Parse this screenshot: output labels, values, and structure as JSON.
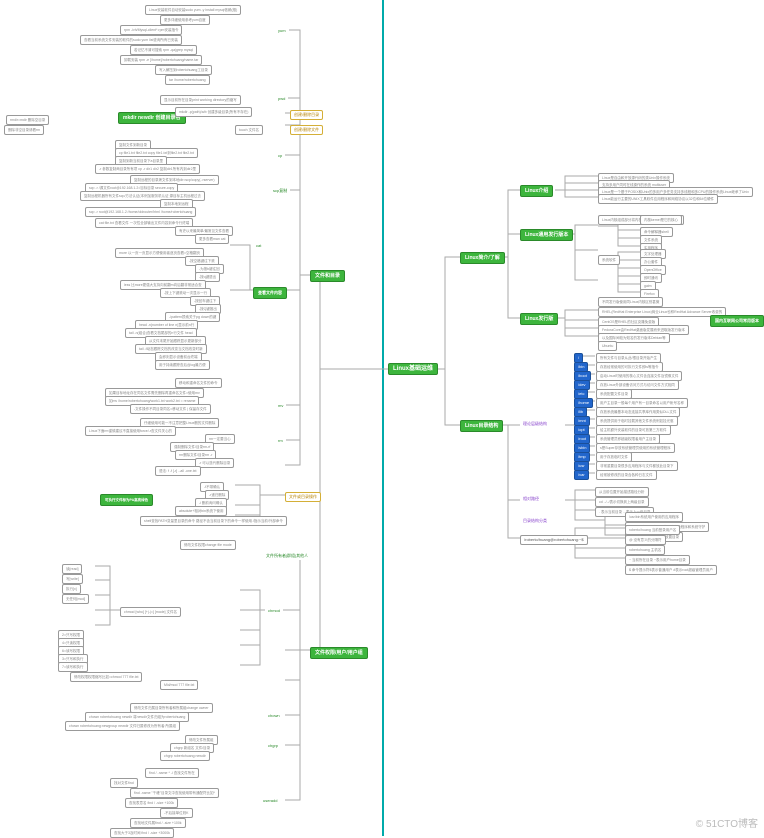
{
  "watermark": "© 51CTO博客",
  "root": "Linux基础运维",
  "right": {
    "intro": {
      "label": "Linux简介/了解",
      "what": {
        "label": "Linux介绍",
        "items": [
          "Linux是自由和开放源代码的类Unix操作系统",
          "支持多用户同时在线操作的系统 multiuser",
          "Linux是一个基于POSIX和Unix的多用户多任务支持多线程和多CPU的操作系统Linux继承了Unix",
          "Linux能运行主要的UNIX工具软件应用程序和网络协议以32位和64位硬件"
        ]
      },
      "distro": {
        "label": "Linux通用发行版本",
        "items": [
          {
            "label": "Linux内核组成部分将内核与不同的应用与服务结合",
            "sub": [
              "内核kernel是它的核心",
              "命令解释器shell",
              "文件系统",
              "实用程序"
            ]
          },
          {
            "label": "系统软件",
            "sub": [
              "文字处理器",
              "GIMP图像",
              "办公套件",
              "OpenOffice",
              "即时通讯",
              "gaim",
              "浏览器",
              "Firefox"
            ]
          },
          {
            "label": "不同发行版使用同Linux内核区别甚微",
            "sub": []
          }
        ]
      },
      "fedora": {
        "label": "Linux发行版",
        "items": [
          "RHEL(RedHat Enterprise Linux)商业Linux也称RedHat Advance Server收费的",
          "CentOS是RHEL的社区克隆免费版",
          "FedoraCore由RedHat桌面版发展而来进取版发行版本",
          "以及国际间较为知名的发行版本Debian等",
          "Ubuntu"
        ],
        "tag": "国内互联网公司常用版本"
      }
    },
    "dir": {
      "label": "Linux目录结构",
      "mainpoint": {
        "label": "理论层级结构",
        "items": [
          {
            "tag": "/",
            "text": "所有文件与目录从此/根目录开始产生"
          },
          {
            "tag": "/bin",
            "text": "存放经常使用的可执行文件即ls等指令"
          },
          {
            "tag": "/boot",
            "text": "启动Linux时使用的核心文件含连接文件及镜像文件"
          },
          {
            "tag": "/dev",
            "text": "存放Linux外部设备访问方式与访问文件方式相同"
          },
          {
            "tag": "/etc",
            "text": "系统配置文件目录"
          },
          {
            "tag": "/home",
            "text": "用户主目录一般每个用户有一目录命名以用户帐号名称"
          },
          {
            "tag": "/lib",
            "text": "存放系统最基本动态连接共享库作用类似DLL文件"
          },
          {
            "tag": "/mnt",
            "text": "系统提供用于临时挂载其他文件系统例如挂光驱"
          },
          {
            "tag": "/opt",
            "text": "给主机额外安装软件的目录可放第三方软件"
          },
          {
            "tag": "/root",
            "text": "系统管理员即超级权限者用户主目录"
          },
          {
            "tag": "/sbin",
            "text": "s是Super存放系统管理员使用的系统管理程序"
          },
          {
            "tag": "/tmp",
            "text": "用于存放临时文件"
          },
          {
            "tag": "/usr",
            "text": "非常重要目录很多应用程序与文件都放此目录下",
            "sub": [
              "/usr/bin系统用户使用的应用程序",
              "/usr/sbin超级用户使用的比较高级程序和系统守护",
              "/usr/src内核源代码默认放置目录"
            ]
          },
          {
            "tag": "/var",
            "text": "经常被修改的目录含各种日志文件"
          }
        ]
      },
      "relpath": {
        "label": "相对路径",
        "items": [
          "从当前位置开始描述路径分析",
          "cd ../../表示切换到上两级目录",
          ". 表示当前目录 .. 表示上一级目录"
        ]
      },
      "format": {
        "label": "目录结构分类",
        "items": [
          "严格区分大小写",
          "目录与文件名称不能超过255字符",
          "除了/之外所有字符都合法",
          "-. 空格字符最好不要使用"
        ]
      },
      "user": {
        "label": "/roberto/huang@robertohuang:~$",
        "items": [
          "roberto/huang 当前登录用户名",
          "@ 没有意义的分隔符",
          "robertohuang 主机名",
          "~ 当前所在目录 ~表示用户home目录",
          "$ 命令提示符$表示普通用户 #表示root超级管理员用户"
        ]
      }
    }
  },
  "left": {
    "yum": {
      "label": "yum",
      "items": [
        "Linux安装软件自动安装sudo yum -y install mysql依赖(推)",
        "更多详细使用参考yum百度",
        "rpm -ivh/Mysql-client*.rpm安装指令",
        "查看当前系统文件安装的软件的sudo yum list查询所有已安装",
        "若记忆不清可搜索 rpm -qa|grep mysql",
        "卸载安装 rpm -e [/home]/robertohuang/name.tar",
        "写入解压到robertohuang工目录",
        "tar /home/robertohuang"
      ]
    },
    "pwd": {
      "label": "pwd",
      "text": "显示目前所在目录print working directory的缩写"
    },
    "mkdir": {
      "label": "创建/删除目录",
      "items": [
        "mkdir newdir 创建目录名",
        "mkdir -p(path)/a/b 创建多级目录(所有不存在)",
        "rmdir=mdir 删除空目录",
        "删除非空目录请看rm"
      ]
    },
    "touch": {
      "label": "创建/删除文件",
      "items": [
        "touch 文件名"
      ]
    },
    "cp": {
      "label": "cp",
      "items": [
        "复制文件到新目录",
        "cp file1.txt file2.txt copy file1.txt到file2.txt file2.txt",
        "复制到新当前目录下a目录里",
        "-r 参数复制两目录所有项 cp -r dir1 dir2 复制dir1所有内到dir2里",
        "远程拷贝 scp/server-copy文件"
      ]
    },
    "scp": {
      "label": "scp复制",
      "items": [
        "复制远程的目录拷文件到本地dir=scp/copy(->server)",
        "scp -r /源文件root@192.168.1.2:/目标目录 secure-copy",
        "复制远程机器所有文件scp/方法认证(本例加服务机认证 源目标主机远程过去",
        "复制本地到远程",
        "scp -r root@192.168.1.2:/home/oldrouter/html /home/robertohuang"
      ]
    },
    "filedir": {
      "label": "文件和目录",
      "cat": {
        "label": "cat",
        "items": [
          "cat file.txt 查看文件 一次性全部输出文件内容到命令行终端",
          "有史以来最简单/最常见文件查看",
          "更多查看man cat"
        ]
      },
      "view": {
        "label": "查看文件内容",
        "items": [
          "more 以一页一页显示方便使用者逐页查看=空格翻页",
          "-按空格键往下滚",
          "-为按b键往回",
          "-按q键退出",
          "less 比more更强大支持向前翻m向后翻非常适合查",
          "-按上下键滚动一次显示一行",
          "-按回车键往下",
          "-按Q键推出",
          "-/pattern损索关于pg down的键",
          "head -n(number of line n)显示前n行",
          "tail -n(组合)查看文档尾部的n行文件 head",
          "从文件末尾开始跟踪显示更新部分",
          "tail -f动态跟踪文档的改变当文档改变时新",
          "会即刻显示设备前台终端",
          "用于持续跟踪查后台log最方便"
        ]
      },
      "mv": {
        "label": "mv",
        "items": [
          "移动和重命名文件的命令",
          "如果目标地址存在同名文件需先删除再重命名文件=使用mv",
          "如mv /home/robertohuang/work1.txt work2.txt = rename",
          "-文件操作不同目录同名=移动文件 | 保留存文件"
        ]
      },
      "rm": {
        "label": "rm",
        "items": [
          "仔细使用可能一不注意把整Linux删的文件删除",
          "Linux下面rm谨慎建议不直接使用force/-r查文件关心的",
          "rm一定要当心",
          "强制删除文件/目录rm-rf",
          "rm删除文件/目录rm -r",
          "-r 可以迭代删除目录",
          "语法: f -f [-r] .-all    -one.txt"
        ]
      },
      "special": {
        "label": "文件或目录操作",
        "items": [
          "-f不带确认",
          "-r递归删除",
          "-i 删前询问确认",
          "absolute+相对bin系统下使用",
          "目录需加-f指定使用\\",
          "可执行文件标为PA高亮绿色",
          "shell查找PATH变量里目录的命令 路径不含当前目录下的命令一样使用./指示当前/外部命令"
        ]
      }
    },
    "chmod": {
      "label": "chmod",
      "desc": "修改文件权限change file mode",
      "table": {
        "rows": [
          [
            "权限",
            "读[read]",
            "r",
            "4",
            "可选标识权限"
          ],
          [
            "",
            "写[write]",
            "w",
            "2",
            "可修改文件"
          ],
          [
            "",
            "执行[x]",
            "x",
            "1",
            ""
          ],
          [
            "",
            "无任何[mod]",
            "-",
            "0",
            ""
          ]
        ]
      },
      "roles": "文件所有者|群组|其他人",
      "command": "chmod [who] [+|-|=] [mode] 文件名",
      "examples": [
        "2=只写权限",
        "4=只读权限",
        "6=读写权限",
        "3=只写和执行",
        "7=读写和执行",
        "修改权限权限缩写比如=chmod 777 file.txt",
        "Mid/mod 777 file.txt"
      ]
    },
    "chown": {
      "label": "chown",
      "items": [
        "修改文件归属目录所有者和所属组change owner",
        "chown robertohuang newdir 将newdir文件归组为robertohuang",
        "chown robertohuang:newgroup newdir 文件归属修改为所有者:所属组"
      ]
    },
    "chgrp": {
      "label": "chgrp",
      "items": [
        "修改文件所属组",
        "chgrp 新组名 文件/目录",
        "chgrp robertohuang newdir"
      ]
    },
    "useradd": {
      "label": "useradd",
      "items": [
        "添加用户",
        "find / -name * -i 查找文件所在",
        "找对文件find",
        "find / -name * find",
        "find -name \"千峰\"目录文中查找使用带有通配符比如*",
        "查找表意名 find / -size +100k",
        "-不后接单位则K",
        "查找地文件展find / -size +100k",
        "查找大于3及时间 find / -size +3000k",
        "find -size 措施>小于 T使用*"
      ]
    },
    "perm": {
      "label": "文件权限/用户/用户组"
    }
  }
}
